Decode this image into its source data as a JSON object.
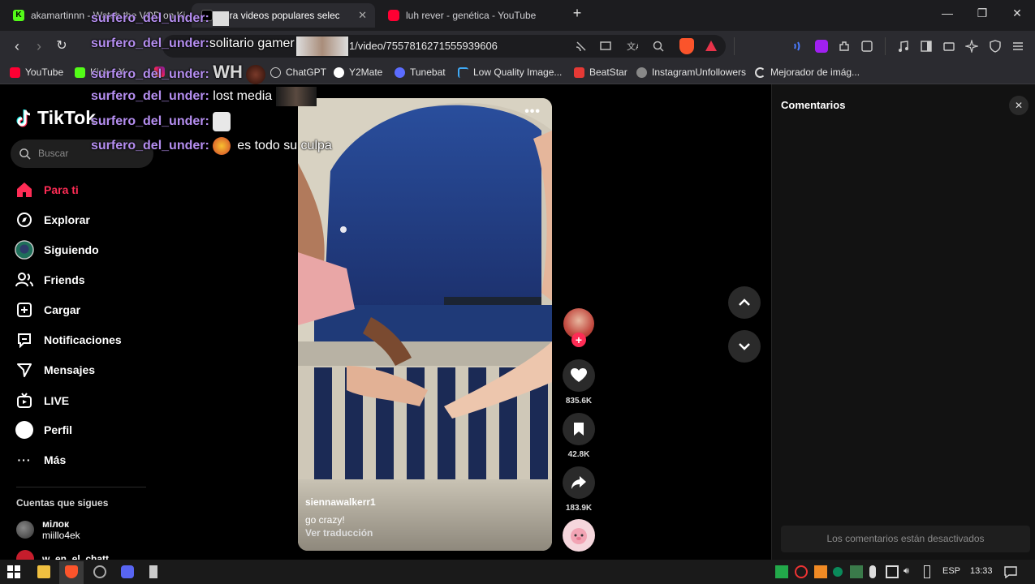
{
  "browser": {
    "tabs": [
      {
        "title": "akamartinnn - Watch the VOD on Ki",
        "active": false
      },
      {
        "title": "Mira videos populares seleccionados",
        "active": true
      },
      {
        "title": "luh rever - genética - YouTube",
        "active": false
      }
    ],
    "new_tab": "+",
    "window_controls": {
      "minimize": "—",
      "restore": "❐",
      "close": "✕"
    },
    "url": "1/video/7557816271555939606",
    "bookmarks": [
      "YouTube",
      "Kick",
      "X",
      "Instagram",
      "WhatsApp",
      "ChatGPT",
      "Y2Mate",
      "Tunebat",
      "Low Quality Image...",
      "BeatStar",
      "InstagramUnfollowers",
      "Mejorador de imág..."
    ]
  },
  "tiktok": {
    "logo": "TikTok",
    "search_placeholder": "Buscar",
    "nav": [
      {
        "label": "Para ti",
        "icon": "home-icon"
      },
      {
        "label": "Explorar",
        "icon": "compass-icon"
      },
      {
        "label": "Siguiendo",
        "icon": "following-icon"
      },
      {
        "label": "Friends",
        "icon": "friends-icon"
      },
      {
        "label": "Cargar",
        "icon": "upload-icon"
      },
      {
        "label": "Notificaciones",
        "icon": "notifications-icon"
      },
      {
        "label": "Mensajes",
        "icon": "messages-icon"
      },
      {
        "label": "LIVE",
        "icon": "live-icon"
      },
      {
        "label": "Perfil",
        "icon": "profile-icon"
      },
      {
        "label": "Más",
        "icon": "more-icon"
      }
    ],
    "following_title": "Cuentas que sigues",
    "following": [
      {
        "display": "мілок",
        "handle": "miillo4ek"
      },
      {
        "display": "w_en_el_chatt",
        "handle": ""
      }
    ],
    "video": {
      "username": "siennawalkerr1",
      "caption": "go crazy!",
      "translate": "Ver traducción",
      "more": "•••"
    },
    "actions": {
      "likes": "835.6K",
      "saves": "42.8K",
      "shares": "183.9K"
    },
    "comments": {
      "title": "Comentarios",
      "disabled": "Los comentarios están desactivados"
    }
  },
  "chat_overlay": [
    {
      "user": "surfero_del_under:",
      "message": ""
    },
    {
      "user": "surfero_del_under:",
      "message": "solitario gamer"
    },
    {
      "user": "surfero_del_under:",
      "message": "WH"
    },
    {
      "user": "surfero_del_under:",
      "message": "lost media"
    },
    {
      "user": "surfero_del_under:",
      "message": ""
    },
    {
      "user": "surfero_del_under:",
      "message": "es todo su culpa"
    }
  ],
  "taskbar": {
    "language": "ESP",
    "time": "13:33"
  },
  "colors": {
    "accent": "#fe2c55",
    "chat_user": "#b58ef0",
    "background": "#000000",
    "panel": "#121212"
  }
}
